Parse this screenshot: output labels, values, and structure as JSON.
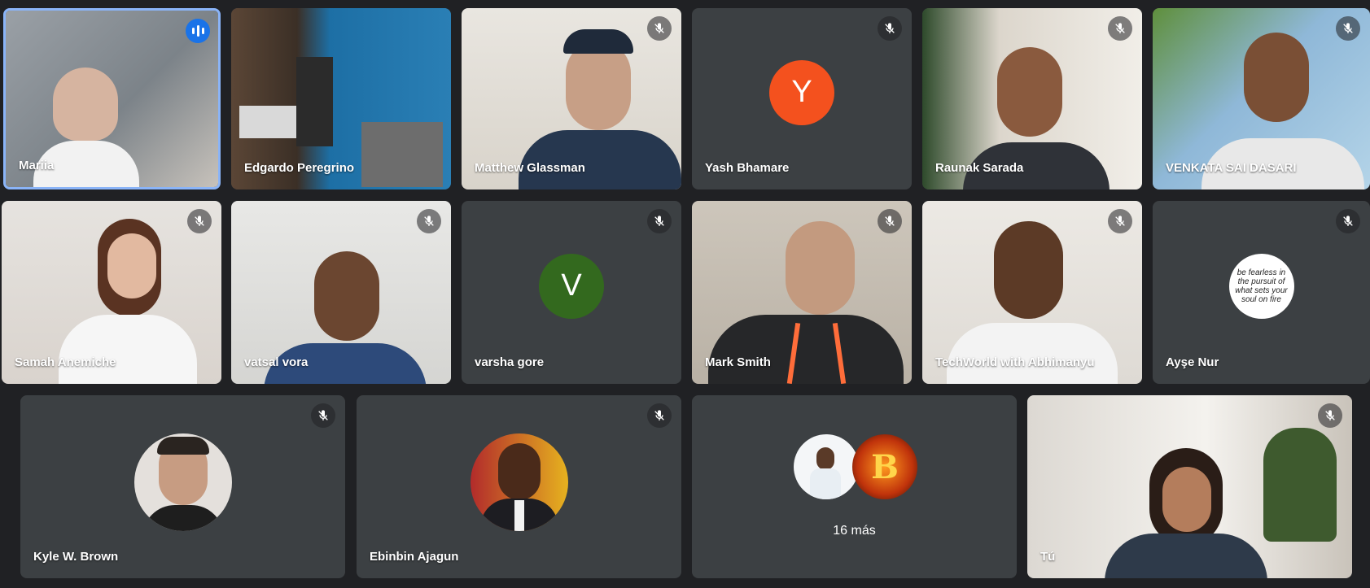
{
  "participants": [
    {
      "name": "Mariia"
    },
    {
      "name": "Edgardo Peregrino"
    },
    {
      "name": "Matthew Glassman"
    },
    {
      "name": "Yash Bhamare",
      "initial": "Y",
      "avatar_color": "#f4511e"
    },
    {
      "name": "Raunak Sarada"
    },
    {
      "name": "VENKATA SAI DASARI"
    },
    {
      "name": "Samah Anemiche"
    },
    {
      "name": "vatsal vora"
    },
    {
      "name": "varsha gore",
      "initial": "V",
      "avatar_color": "#33691e"
    },
    {
      "name": "Mark Smith"
    },
    {
      "name": "TechWorld with Abhimanyu"
    },
    {
      "name": "Ayşe Nur",
      "avatar_text": "be fearless in the pursuit of what sets your soul on fire"
    },
    {
      "name": "Kyle W. Brown"
    },
    {
      "name": "Ebinbin Ajagun"
    },
    {
      "name": "Tú"
    }
  ],
  "more": {
    "label": "16 más",
    "avatar_letter": "B"
  },
  "colors": {
    "background": "#202124",
    "tile": "#3c4043",
    "speaking_border": "#8ab4f8",
    "speaking_badge": "#1a73e8"
  }
}
